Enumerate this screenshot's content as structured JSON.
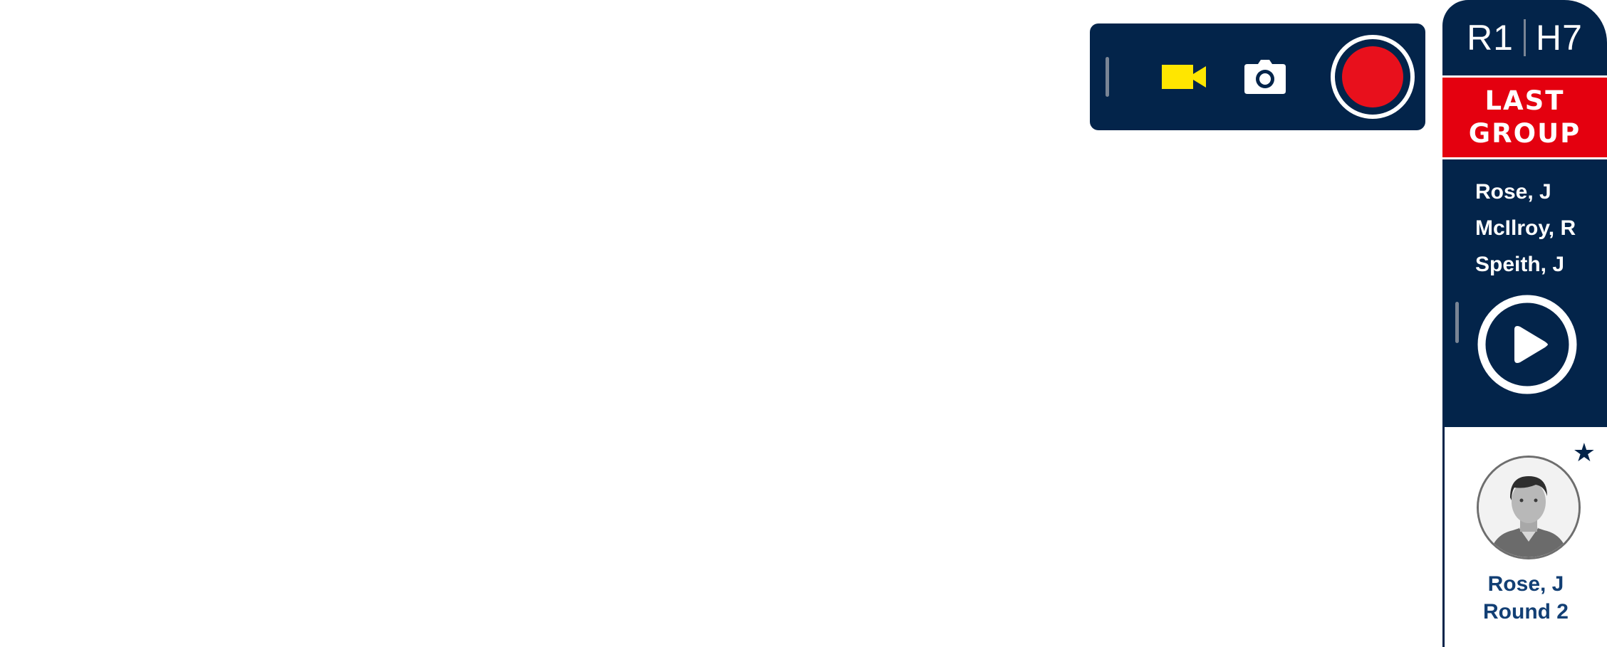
{
  "toolbar": {
    "icons": {
      "handle": "drag-handle",
      "video": "video-camera-icon",
      "camera": "camera-icon",
      "record": "record-button"
    },
    "colors": {
      "background": "#03244a",
      "video_icon": "#ffe600",
      "record": "#e8101c"
    }
  },
  "sidebar": {
    "header": {
      "round": "R1",
      "hole": "H7"
    },
    "banner": {
      "line1": "LAST",
      "line2": "GROUP",
      "color": "#e4000f"
    },
    "group": {
      "players": [
        "Rose, J",
        "McIlroy, R",
        "Speith, J"
      ],
      "play_icon": "play-icon"
    },
    "card": {
      "star_icon": "star-icon",
      "player_name": "Rose, J",
      "round": "Round 2",
      "name_color": "#123f74"
    },
    "colors": {
      "navy": "#03244a"
    }
  }
}
